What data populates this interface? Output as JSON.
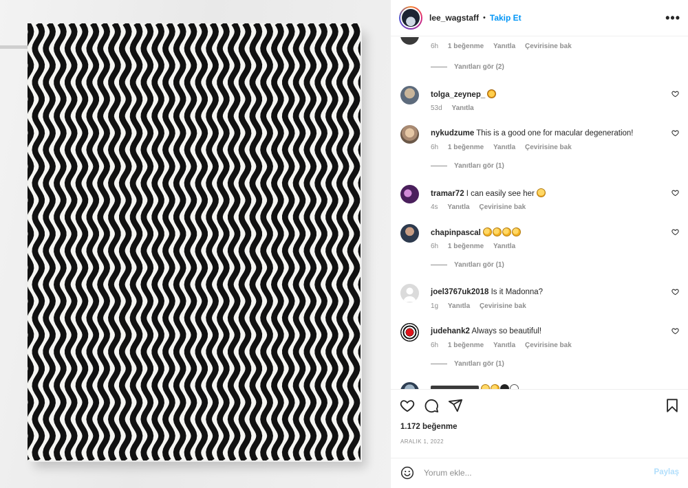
{
  "media": {
    "alt": ""
  },
  "header": {
    "username": "lee_wagstaff",
    "separator": "•",
    "follow_label": "Takip Et",
    "more_label": "•••"
  },
  "comments": [
    {
      "username": "",
      "text": "",
      "time": "6h",
      "likes": "1 beğenme",
      "reply": "Yanıtla",
      "translate": "Çevirisine bak",
      "replies": "Yanıtları gör (2)"
    },
    {
      "username": "tolga_zeynep_",
      "text": "",
      "emoji": [
        "hands"
      ],
      "time": "53d",
      "reply": "Yanıtla"
    },
    {
      "username": "nykudzume",
      "text": "This is a good one for macular degeneration!",
      "time": "6h",
      "likes": "1 beğenme",
      "reply": "Yanıtla",
      "translate": "Çevirisine bak",
      "replies": "Yanıtları gör (1)"
    },
    {
      "username": "tramar72",
      "text": "I can easily see her",
      "emoji": [
        "smile"
      ],
      "time": "4s",
      "reply": "Yanıtla",
      "translate": "Çevirisine bak"
    },
    {
      "username": "chapinpascal",
      "text": "",
      "emoji": [
        "clap",
        "clap",
        "clap",
        "clap"
      ],
      "time": "6h",
      "likes": "1 beğenme",
      "reply": "Yanıtla",
      "replies": "Yanıtları gör (1)"
    },
    {
      "username": "joel3767uk2018",
      "text": "Is it Madonna?",
      "time": "1g",
      "reply": "Yanıtla",
      "translate": "Çevirisine bak"
    },
    {
      "username": "judehank2",
      "text": "Always so beautiful!",
      "time": "6h",
      "likes": "1 beğenme",
      "reply": "Yanıtla",
      "translate": "Çevirisine bak",
      "replies": "Yanıtları gör (1)"
    },
    {
      "username": "",
      "text": ""
    }
  ],
  "actions": {
    "likes": "1.172 beğenme",
    "date": "ARALIK 1, 2022"
  },
  "comment_box": {
    "placeholder": "Yorum ekle...",
    "post_label": "Paylaş"
  },
  "icons": [
    "heart-icon",
    "comment-icon",
    "share-icon",
    "bookmark-icon",
    "emoji-icon",
    "more-icon"
  ],
  "colors": {
    "accent": "#0095f6",
    "post_disabled": "#b2dffc",
    "muted": "#8e8e8e"
  }
}
